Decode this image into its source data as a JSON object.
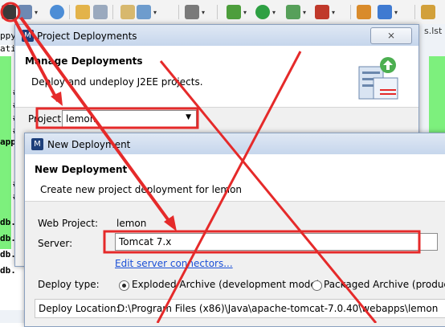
{
  "background": {
    "tab_partial": "s.lst",
    "gutter_texts": [
      "ppy",
      "atio",
      "app"
    ],
    "side_lines": [
      "#",
      "#",
      "#",
      "#",
      "#",
      "#",
      "db.",
      "db.",
      "db.",
      "db."
    ]
  },
  "project_deployments": {
    "title": "Project Deployments",
    "close_glyph": "⨯",
    "header_title": "Manage Deployments",
    "header_desc": "Deploy and undeploy J2EE projects.",
    "project_label": "Project",
    "project_value": "lemon"
  },
  "new_deployment": {
    "title": "New Deployment",
    "header_title": "New Deployment",
    "header_desc": "Create new project deployment for lemon",
    "web_project_label": "Web Project:",
    "web_project_value": "lemon",
    "server_label": "Server:",
    "server_value": "Tomcat  7.x",
    "edit_link": "Edit server connectors...",
    "deploy_type_label": "Deploy type:",
    "radio_exploded": "Exploded Archive (development mode)",
    "radio_packaged": "Packaged Archive (producti",
    "deploy_location_label": "Deploy Location:",
    "deploy_location_value": "D:\\Program Files (x86)\\Java\\apache-tomcat-7.0.40\\webapps\\lemon"
  },
  "colors": {
    "annotation_red": "#e52a2a",
    "green_margin": "#7df07d"
  }
}
